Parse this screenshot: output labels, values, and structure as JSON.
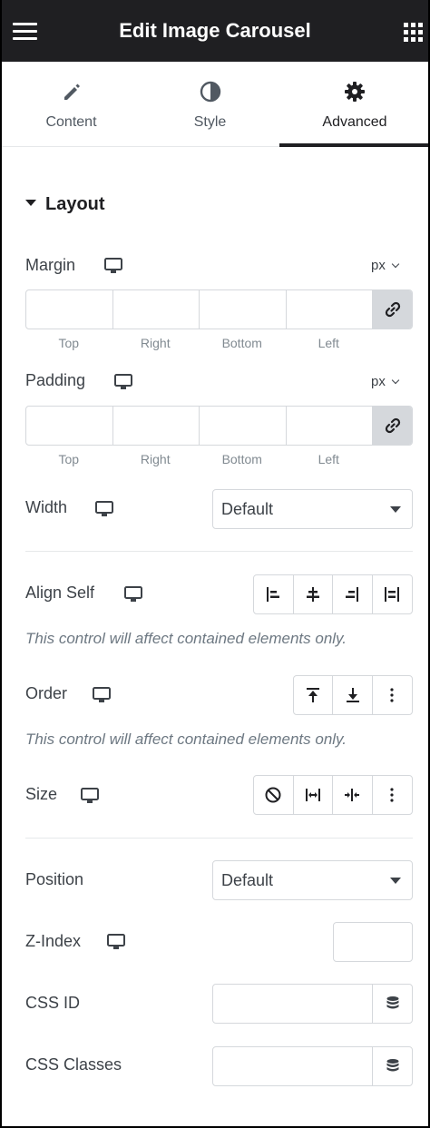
{
  "header": {
    "title": "Edit Image Carousel",
    "menu_icon": "hamburger-icon",
    "apps_icon": "grid-icon"
  },
  "tabs": [
    {
      "label": "Content",
      "icon": "pencil-icon",
      "active": false
    },
    {
      "label": "Style",
      "icon": "half-circle-icon",
      "active": false
    },
    {
      "label": "Advanced",
      "icon": "gear-icon",
      "active": true
    }
  ],
  "section": {
    "title": "Layout"
  },
  "margin": {
    "label": "Margin",
    "unit": "px",
    "sides": [
      "Top",
      "Right",
      "Bottom",
      "Left"
    ],
    "values": [
      "",
      "",
      "",
      ""
    ]
  },
  "padding": {
    "label": "Padding",
    "unit": "px",
    "sides": [
      "Top",
      "Right",
      "Bottom",
      "Left"
    ],
    "values": [
      "",
      "",
      "",
      ""
    ]
  },
  "width": {
    "label": "Width",
    "value": "Default"
  },
  "align_self": {
    "label": "Align Self",
    "note": "This control will affect contained elements only."
  },
  "order": {
    "label": "Order",
    "note": "This control will affect contained elements only."
  },
  "size": {
    "label": "Size"
  },
  "position": {
    "label": "Position",
    "value": "Default"
  },
  "zindex": {
    "label": "Z-Index",
    "value": ""
  },
  "css_id": {
    "label": "CSS ID",
    "value": ""
  },
  "css_classes": {
    "label": "CSS Classes",
    "value": ""
  },
  "colors": {
    "topbar": "#1f1f22",
    "border": "#d5d8dc",
    "text": "#3d4248",
    "muted": "#818a91"
  }
}
